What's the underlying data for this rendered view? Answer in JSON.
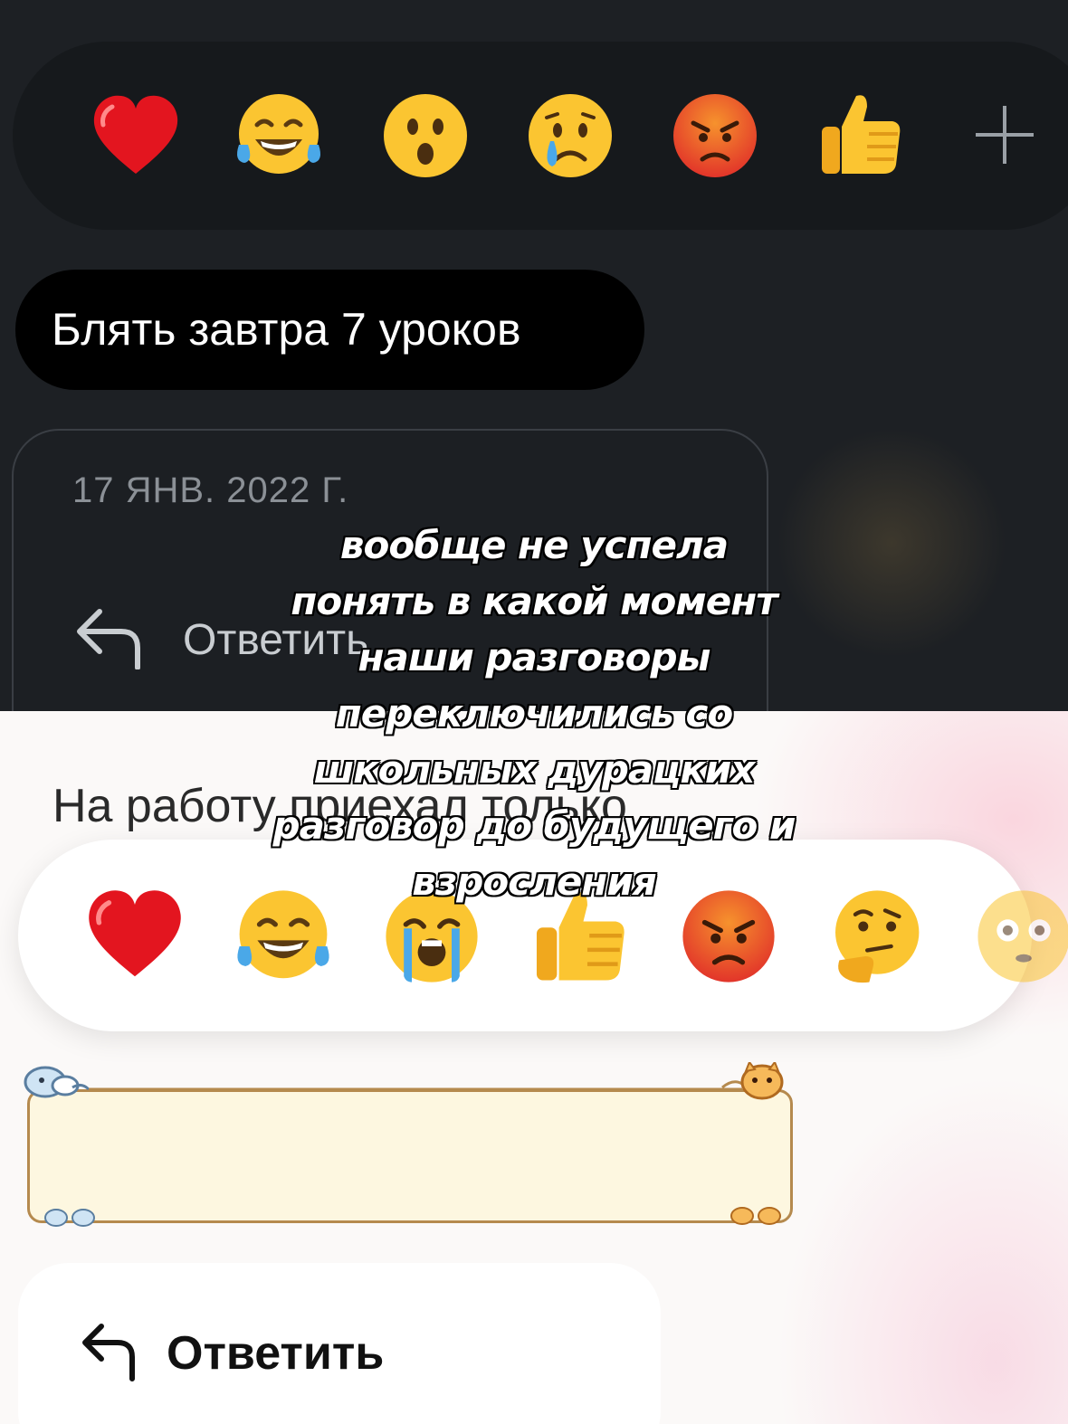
{
  "top_panel": {
    "reactions": [
      {
        "icon": "red-heart-icon"
      },
      {
        "icon": "tears-of-joy-icon"
      },
      {
        "icon": "surprised-face-icon"
      },
      {
        "icon": "crying-face-icon"
      },
      {
        "icon": "angry-face-icon"
      },
      {
        "icon": "thumbs-up-icon"
      },
      {
        "icon": "plus-icon"
      }
    ],
    "message": "Блять завтра 7 уроков",
    "date": "17 ЯНВ. 2022 Г.",
    "reply_label": "Ответить"
  },
  "bottom_panel": {
    "reactions": [
      {
        "icon": "red-heart-icon"
      },
      {
        "icon": "tears-of-joy-icon"
      },
      {
        "icon": "loudly-crying-face-icon"
      },
      {
        "icon": "thumbs-up-icon"
      },
      {
        "icon": "angry-face-icon"
      },
      {
        "icon": "thinking-face-icon"
      },
      {
        "icon": "flushed-face-icon"
      }
    ],
    "message": "На работу приехал только",
    "reply_label": "Ответить"
  },
  "caption": {
    "lines": [
      "вообще не успела",
      "понять в какой момент",
      "наши разговоры",
      "переключились со",
      "школьных дурацких",
      "разговор до будущего и",
      "взросления"
    ]
  },
  "colors": {
    "dark_bg": "#1d2024",
    "dark_bubble": "#000000",
    "light_bg": "#fbf9f8",
    "bubble_frame": "#b58a4e",
    "bubble_fill": "#fdf7e0"
  }
}
